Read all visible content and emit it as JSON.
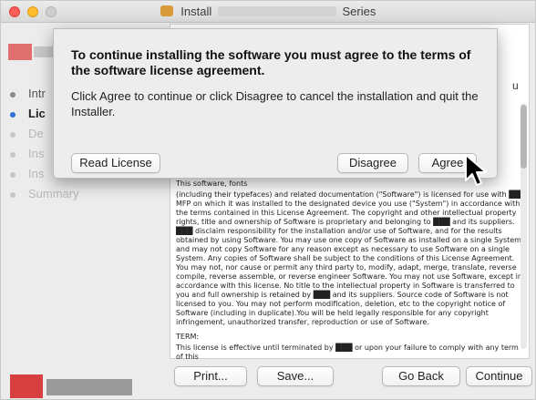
{
  "window": {
    "title_prefix": "Install",
    "title_suffix": "Series"
  },
  "sidebar": {
    "steps": [
      {
        "label": "Intr"
      },
      {
        "label": "Lic"
      },
      {
        "label": "De"
      },
      {
        "label": "Ins"
      },
      {
        "label": "Ins"
      },
      {
        "label": "Summary"
      }
    ]
  },
  "content": {
    "fragment_right": "u",
    "license_paragraphs": [
      "This software, fonts",
      "(including their typefaces) and related documentation (\"Software\") is licensed for use with ███ MFP on which it was installed to the designated device you use (\"System\") in accordance with the terms contained in this License Agreement. The copyright and other intellectual property rights, title and ownership of Software is proprietary and belonging to ███ and its suppliers. ███ disclaim responsibility for the installation and/or use of Software, and for the results obtained by using Software. You may use one copy of Software as installed on a single System, and may not copy Software for any reason except as necessary to use Software on a single System. Any copies of Software shall be subject to the conditions of this License Agreement. You may not, nor cause or permit any third party to, modify, adapt, merge, translate, reverse compile, reverse assemble, or reverse engineer Software. You may not use Software, except in accordance with this license. No title to the intellectual property in Software is transferred to you and full ownership is retained by ███ and its suppliers. Source code of Software is not licensed to you. You may not perform modification, deletion, etc to the copyright notice of Software (including in duplicate).You will be held legally responsible for any copyright infringement, unauthorized transfer, reproduction or use of Software.",
      "TERM:",
      "This license is effective until terminated by ███ or upon your failure to comply with any term of this"
    ]
  },
  "bottom_bar": {
    "print_label": "Print...",
    "save_label": "Save...",
    "goback_label": "Go Back",
    "continue_label": "Continue"
  },
  "sheet": {
    "title": "To continue installing the software you must agree to the terms of the software license agreement.",
    "message": "Click Agree to continue or click Disagree to cancel the installation and quit the Installer.",
    "read_license_label": "Read License",
    "disagree_label": "Disagree",
    "agree_label": "Agree"
  },
  "colors": {
    "active_step_dot": "#2f6fd6",
    "close_button": "#fd5f57",
    "minimize_button": "#fdbd2e",
    "logo_red": "#d84040"
  },
  "icons": [
    "package-icon",
    "pointer-cursor-icon"
  ]
}
